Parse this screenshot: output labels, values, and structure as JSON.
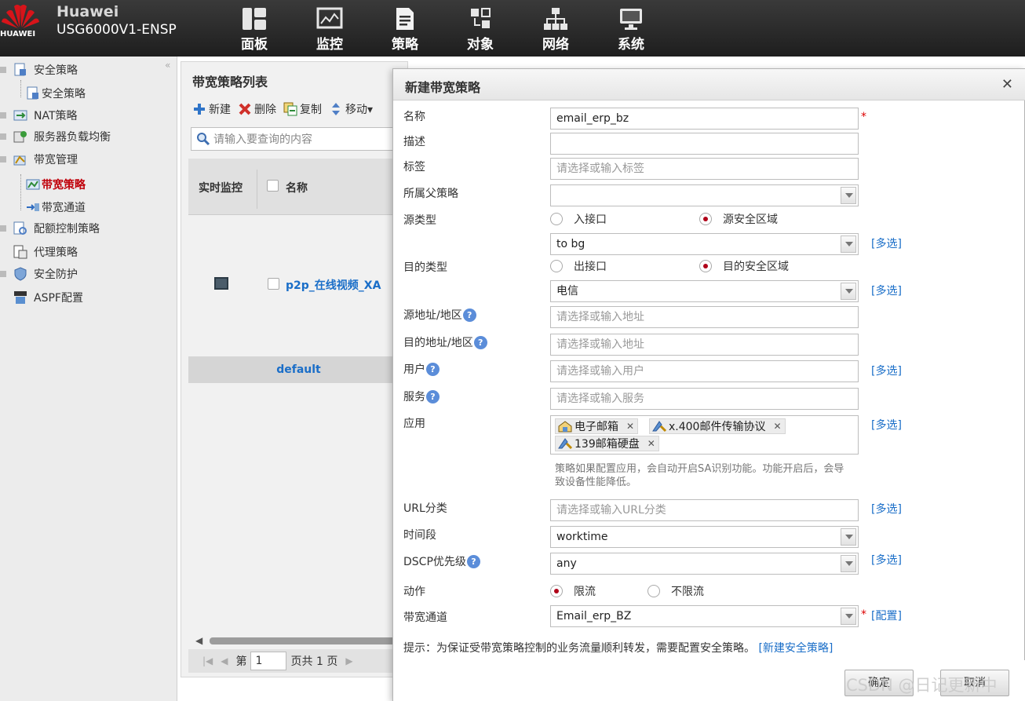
{
  "brand": {
    "logo_text": "HUAWEI",
    "name": "Huawei",
    "model": "USG6000V1-ENSP"
  },
  "nav": [
    {
      "label": "面板",
      "icon": "dashboard-icon"
    },
    {
      "label": "监控",
      "icon": "monitor-icon"
    },
    {
      "label": "策略",
      "icon": "policy-icon"
    },
    {
      "label": "对象",
      "icon": "object-icon"
    },
    {
      "label": "网络",
      "icon": "network-icon"
    },
    {
      "label": "系统",
      "icon": "system-icon"
    }
  ],
  "sidebar": {
    "collapse": "«",
    "items": [
      {
        "label": "安全策略"
      },
      {
        "label": "安全策略"
      },
      {
        "label": "NAT策略"
      },
      {
        "label": "服务器负载均衡"
      },
      {
        "label": "带宽管理"
      },
      {
        "label": "带宽策略"
      },
      {
        "label": "带宽通道"
      },
      {
        "label": "配额控制策略"
      },
      {
        "label": "代理策略"
      },
      {
        "label": "安全防护"
      },
      {
        "label": "ASPF配置"
      }
    ]
  },
  "list": {
    "title": "带宽策略列表",
    "toolbar": {
      "new": "新建",
      "delete": "删除",
      "copy": "复制",
      "move": "移动▾"
    },
    "search_placeholder": "请输入要查询的内容",
    "columns": {
      "monitor": "实时监控",
      "name": "名称"
    },
    "rows": [
      {
        "name": "p2p_在线视频_XA"
      }
    ],
    "default_row": "default",
    "pager": {
      "first": "|◀",
      "prev": "◀",
      "page_prefix": "第",
      "page": "1",
      "page_suffix": "页共 1 页",
      "next": "▶"
    }
  },
  "dialog": {
    "title": "新建带宽策略",
    "close": "✕",
    "fields": {
      "name": {
        "label": "名称",
        "value": "email_erp_bz"
      },
      "description": {
        "label": "描述",
        "value": ""
      },
      "tag": {
        "label": "标签",
        "placeholder": "请选择或输入标签"
      },
      "parent": {
        "label": "所属父策略",
        "value": ""
      },
      "src_type": {
        "label": "源类型",
        "opt1": "入接口",
        "opt2": "源安全区域",
        "selected": "源安全区域"
      },
      "src_zone": {
        "value": "to bg"
      },
      "dst_type": {
        "label": "目的类型",
        "opt1": "出接口",
        "opt2": "目的安全区域",
        "selected": "目的安全区域"
      },
      "dst_zone": {
        "value": "电信"
      },
      "src_addr": {
        "label": "源地址/地区",
        "placeholder": "请选择或输入地址"
      },
      "dst_addr": {
        "label": "目的地址/地区",
        "placeholder": "请选择或输入地址"
      },
      "user": {
        "label": "用户",
        "placeholder": "请选择或输入用户"
      },
      "service": {
        "label": "服务",
        "placeholder": "请选择或输入服务"
      },
      "application": {
        "label": "应用",
        "tags": [
          "电子邮箱",
          "x.400邮件传输协议",
          "139邮箱硬盘"
        ]
      },
      "app_note": "策略如果配置应用，会自动开启SA识别功能。功能开启后，会导致设备性能降低。",
      "url": {
        "label": "URL分类",
        "placeholder": "请选择或输入URL分类"
      },
      "time": {
        "label": "时间段",
        "value": "worktime"
      },
      "dscp": {
        "label": "DSCP优先级",
        "value": "any"
      },
      "action": {
        "label": "动作",
        "opt1": "限流",
        "opt2": "不限流",
        "selected": "限流"
      },
      "channel": {
        "label": "带宽通道",
        "value": "Email_erp_BZ"
      }
    },
    "help": "?",
    "required_mark": "*",
    "multi_select": "[多选]",
    "configure": "[配置]",
    "tip_text": "提示：为保证受带宽策略控制的业务流量顺利转发，需要配置安全策略。",
    "tip_link": "[新建安全策略]",
    "ok": "确定",
    "cancel": "取消"
  },
  "watermark": "CSDN @日记更新中",
  "colors": {
    "header_bg": "#2a2a2a",
    "accent_red": "#c0000a",
    "link_blue": "#1a6ec8"
  }
}
